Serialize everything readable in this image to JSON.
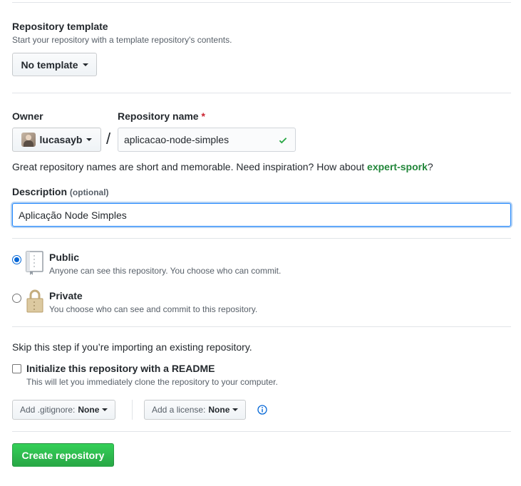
{
  "template": {
    "heading": "Repository template",
    "description": "Start your repository with a template repository's contents.",
    "button_label": "No template"
  },
  "owner": {
    "label": "Owner",
    "username": "lucasayb",
    "separator": "/"
  },
  "repo_name": {
    "label": "Repository name",
    "required_mark": "*",
    "value": "aplicacao-node-simples"
  },
  "suggestion": {
    "prefix": "Great repository names are short and memorable. Need inspiration? How about ",
    "name": "expert-spork",
    "suffix": "?"
  },
  "description": {
    "label": "Description",
    "optional": "(optional)",
    "value": "Aplicação Node Simples"
  },
  "visibility": {
    "selected": "public",
    "public_label": "Public",
    "public_note": "Anyone can see this repository. You choose who can commit.",
    "private_label": "Private",
    "private_note": "You choose who can see and commit to this repository."
  },
  "import_note": "Skip this step if you’re importing an existing repository.",
  "readme": {
    "label": "Initialize this repository with a README",
    "note": "This will let you immediately clone the repository to your computer.",
    "checked": false
  },
  "gitignore": {
    "prefix": "Add .gitignore:",
    "value": "None"
  },
  "license": {
    "prefix": "Add a license:",
    "value": "None"
  },
  "create_button": "Create repository",
  "colors": {
    "primary_button": "#28a745",
    "link": "#0366d6",
    "valid_check": "#28a745",
    "required": "#cb2431"
  }
}
